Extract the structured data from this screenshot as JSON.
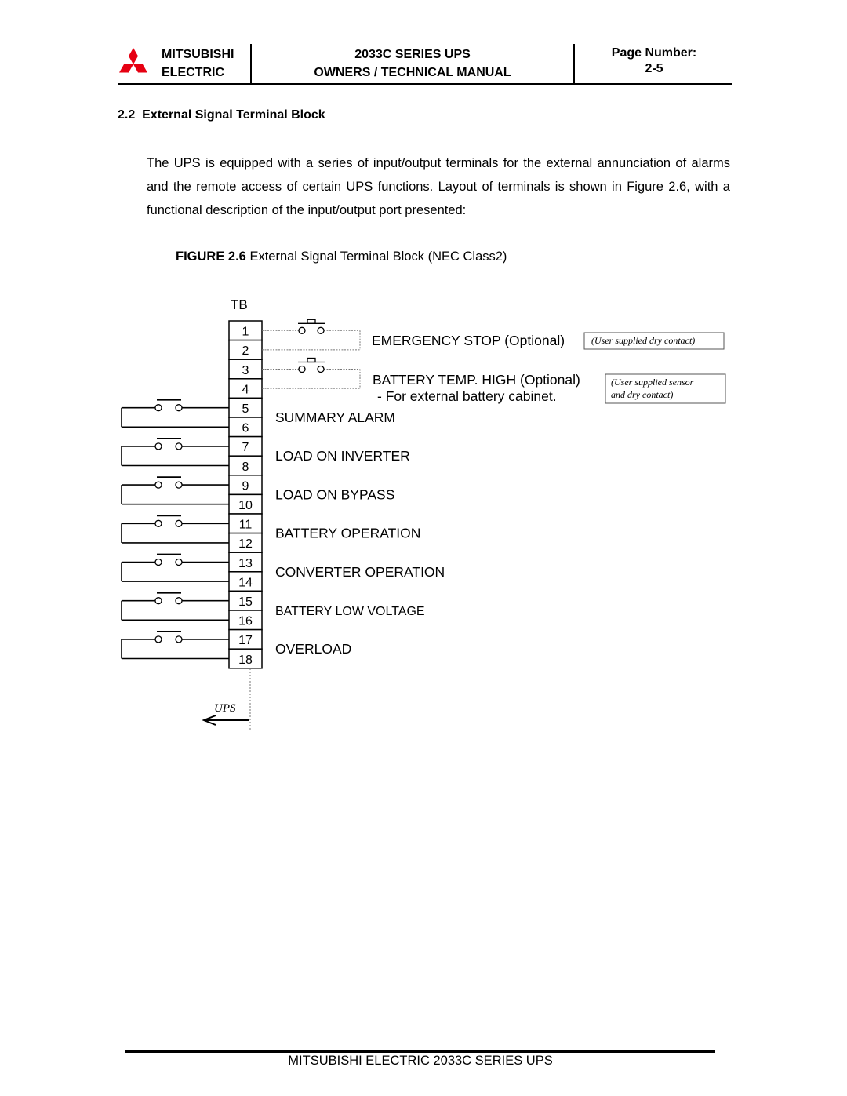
{
  "header": {
    "brand_line1": "MITSUBISHI",
    "brand_line2": "ELECTRIC",
    "logo_color": "#e60012",
    "title_line1": "2033C SERIES UPS",
    "title_line2": "OWNERS / TECHNICAL MANUAL",
    "page_label": "Page Number:",
    "page_value": "2-5"
  },
  "section": {
    "number": "2.2",
    "title": "External Signal Terminal Block",
    "paragraph": "The UPS is equipped with a series of input/output terminals for the external annunciation of alarms and the remote access of certain UPS functions. Layout of terminals is shown in Figure 2.6, with a functional description of the input/output port presented:"
  },
  "figure": {
    "caption_bold": "FIGURE 2.6",
    "caption_rest": " External Signal Terminal Block (NEC Class2)",
    "tb_label": "TB",
    "terminals": [
      "1",
      "2",
      "3",
      "4",
      "5",
      "6",
      "7",
      "8",
      "9",
      "10",
      "11",
      "12",
      "13",
      "14",
      "15",
      "16",
      "17",
      "18"
    ],
    "inputs": [
      {
        "label": "EMERGENCY STOP (Optional)",
        "note": "(User supplied dry contact)"
      },
      {
        "label": "BATTERY TEMP. HIGH (Optional)",
        "sublabel": "- For external battery cabinet.",
        "note_line1": "(User supplied sensor",
        "note_line2": "and dry contact)"
      }
    ],
    "outputs": [
      "SUMMARY ALARM",
      "LOAD ON INVERTER",
      "LOAD ON BYPASS",
      "BATTERY OPERATION",
      "CONVERTER OPERATION",
      "BATTERY LOW VOLTAGE",
      "OVERLOAD"
    ],
    "ups_label": "UPS"
  },
  "footer": {
    "text": "MITSUBISHI ELECTRIC 2033C SERIES UPS"
  }
}
